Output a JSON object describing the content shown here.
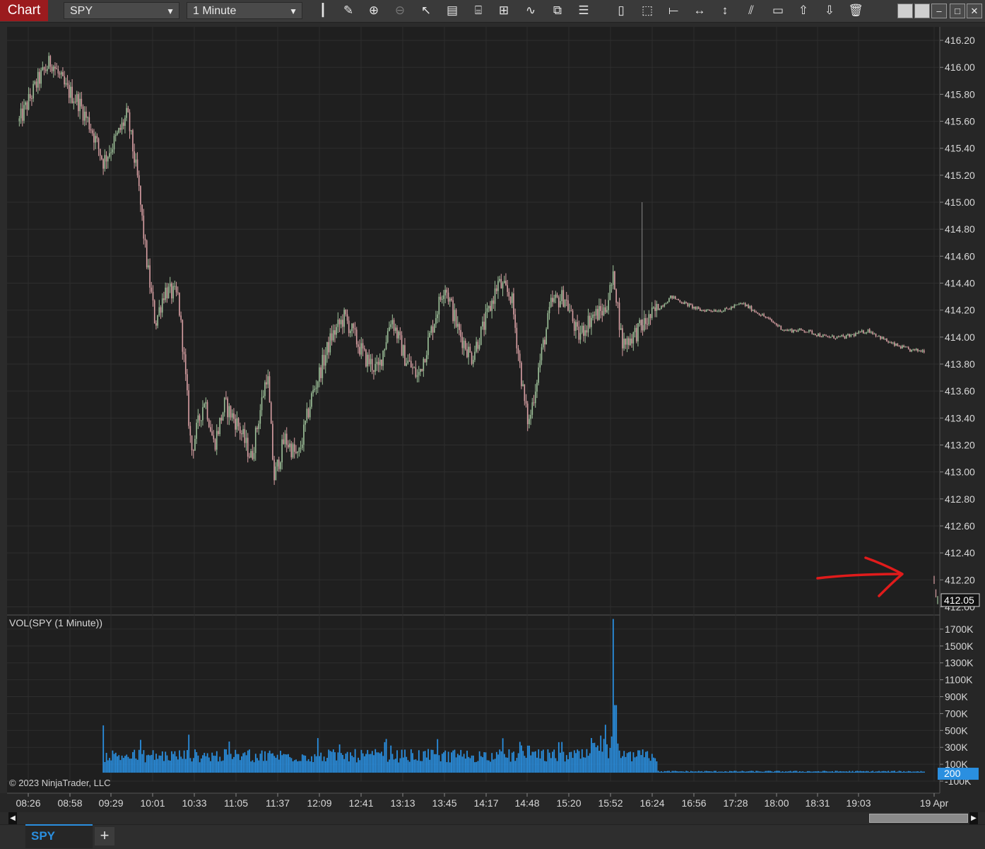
{
  "app": {
    "tab_label": "Chart",
    "instrument": "SPY",
    "interval": "1 Minute"
  },
  "toolbar": {
    "icons": [
      "bar-type-icon",
      "pencil-icon",
      "zoom-in-icon",
      "zoom-out-icon",
      "pointer-icon",
      "data-box-icon",
      "properties-icon",
      "strategies-icon",
      "indicators-icon",
      "templates-icon",
      "list-icon",
      "region-icon",
      "rectangle-select-icon",
      "line-icon",
      "horizontal-arrow-icon",
      "vertical-arrow-icon",
      "parallel-lines-icon",
      "rectangle-icon",
      "arrow-up-icon",
      "arrow-down-icon",
      "trash-icon"
    ],
    "window_buttons": [
      "tile-icon",
      "tile-icon",
      "minimize-icon",
      "maximize-icon",
      "close-icon"
    ]
  },
  "colors": {
    "background": "#1f1f1f",
    "up_candle": "#9ec29a",
    "down_candle": "#d9a0a4",
    "volume": "#2a8fe0",
    "grid": "#2e2e2e",
    "annotation_arrow": "#e01b1b"
  },
  "price_axis": {
    "labels": [
      "416.20",
      "416.00",
      "415.80",
      "415.60",
      "415.40",
      "415.20",
      "415.00",
      "414.80",
      "414.60",
      "414.40",
      "414.20",
      "414.00",
      "413.80",
      "413.60",
      "413.40",
      "413.20",
      "413.00",
      "412.80",
      "412.60",
      "412.40",
      "412.20",
      "412.00"
    ],
    "current_price": "412.05"
  },
  "volume_panel": {
    "title": "VOL(SPY (1 Minute))",
    "axis_labels": [
      "1700K",
      "1500K",
      "1300K",
      "1100K",
      "900K",
      "700K",
      "500K",
      "300K",
      "100K",
      "-100K"
    ],
    "current_volume": "200"
  },
  "time_axis": {
    "labels": [
      "08:26",
      "08:58",
      "09:29",
      "10:01",
      "10:33",
      "11:05",
      "11:37",
      "12:09",
      "12:41",
      "13:13",
      "13:45",
      "14:17",
      "14:48",
      "15:20",
      "15:52",
      "16:24",
      "16:56",
      "17:28",
      "18:00",
      "18:31",
      "19:03",
      "19 Apr"
    ]
  },
  "footer": {
    "copyright": "© 2023 NinjaTrader, LLC"
  },
  "tabs": [
    {
      "label": "SPY"
    }
  ],
  "chart_data": {
    "type": "candlestick",
    "instrument": "SPY",
    "interval": "1 Minute",
    "ylim": [
      411.95,
      416.3
    ],
    "volume_ylim": [
      -100000,
      1850000
    ],
    "price_path": [
      [
        "08:26",
        415.6
      ],
      [
        "08:40",
        415.9
      ],
      [
        "08:50",
        416.05
      ],
      [
        "09:00",
        415.85
      ],
      [
        "09:10",
        415.75
      ],
      [
        "09:20",
        415.55
      ],
      [
        "09:29",
        415.3
      ],
      [
        "09:40",
        415.5
      ],
      [
        "09:47",
        415.65
      ],
      [
        "09:55",
        415.15
      ],
      [
        "10:01",
        414.6
      ],
      [
        "10:08",
        414.1
      ],
      [
        "10:15",
        414.35
      ],
      [
        "10:25",
        414.3
      ],
      [
        "10:29",
        413.9
      ],
      [
        "10:35",
        413.15
      ],
      [
        "10:45",
        413.55
      ],
      [
        "10:52",
        413.2
      ],
      [
        "11:00",
        413.5
      ],
      [
        "11:10",
        413.35
      ],
      [
        "11:20",
        413.1
      ],
      [
        "11:32",
        413.75
      ],
      [
        "11:37",
        412.95
      ],
      [
        "11:45",
        413.25
      ],
      [
        "11:55",
        413.1
      ],
      [
        "12:05",
        413.55
      ],
      [
        "12:20",
        414.0
      ],
      [
        "12:30",
        414.15
      ],
      [
        "12:45",
        413.85
      ],
      [
        "12:55",
        413.75
      ],
      [
        "13:05",
        414.15
      ],
      [
        "13:15",
        413.85
      ],
      [
        "13:25",
        413.7
      ],
      [
        "13:35",
        414.05
      ],
      [
        "13:45",
        414.4
      ],
      [
        "13:55",
        414.05
      ],
      [
        "14:05",
        413.85
      ],
      [
        "14:15",
        414.1
      ],
      [
        "14:25",
        414.4
      ],
      [
        "14:35",
        414.3
      ],
      [
        "14:45",
        413.5
      ],
      [
        "14:48",
        413.35
      ],
      [
        "14:55",
        413.75
      ],
      [
        "15:05",
        414.25
      ],
      [
        "15:15",
        414.3
      ],
      [
        "15:25",
        414.0
      ],
      [
        "15:35",
        414.15
      ],
      [
        "15:45",
        414.2
      ],
      [
        "15:52",
        414.45
      ],
      [
        "15:58",
        413.95
      ],
      [
        "16:05",
        414.0
      ],
      [
        "16:15",
        414.1
      ],
      [
        "16:24",
        414.2
      ],
      [
        "16:35",
        414.3
      ],
      [
        "16:45",
        414.25
      ],
      [
        "16:56",
        414.2
      ],
      [
        "17:15",
        414.2
      ],
      [
        "17:28",
        414.25
      ],
      [
        "17:45",
        414.15
      ],
      [
        "18:00",
        414.05
      ],
      [
        "18:15",
        414.05
      ],
      [
        "18:31",
        414.0
      ],
      [
        "18:45",
        414.0
      ],
      [
        "19:03",
        414.05
      ],
      [
        "19:20",
        413.95
      ],
      [
        "19:35",
        413.9
      ],
      [
        "19:45",
        413.9
      ]
    ],
    "gap_to_next_session": {
      "date": "19 Apr",
      "price_path": [
        412.2,
        412.1,
        412.05
      ]
    },
    "notable_spike_high": {
      "time": "16:13",
      "high": 415.0
    },
    "volume_profile": [
      {
        "time": "09:29",
        "volume": 560000
      },
      {
        "time": "10:33",
        "volume": 450000
      },
      {
        "time": "14:48",
        "volume": 320000
      },
      {
        "time": "15:44",
        "volume": 400000
      },
      {
        "time": "15:52",
        "volume": 1820000
      },
      {
        "time": "15:53",
        "volume": 800000
      },
      {
        "time": "16:24",
        "volume": 80000
      },
      {
        "time": "19:45",
        "volume": 10000
      }
    ]
  }
}
